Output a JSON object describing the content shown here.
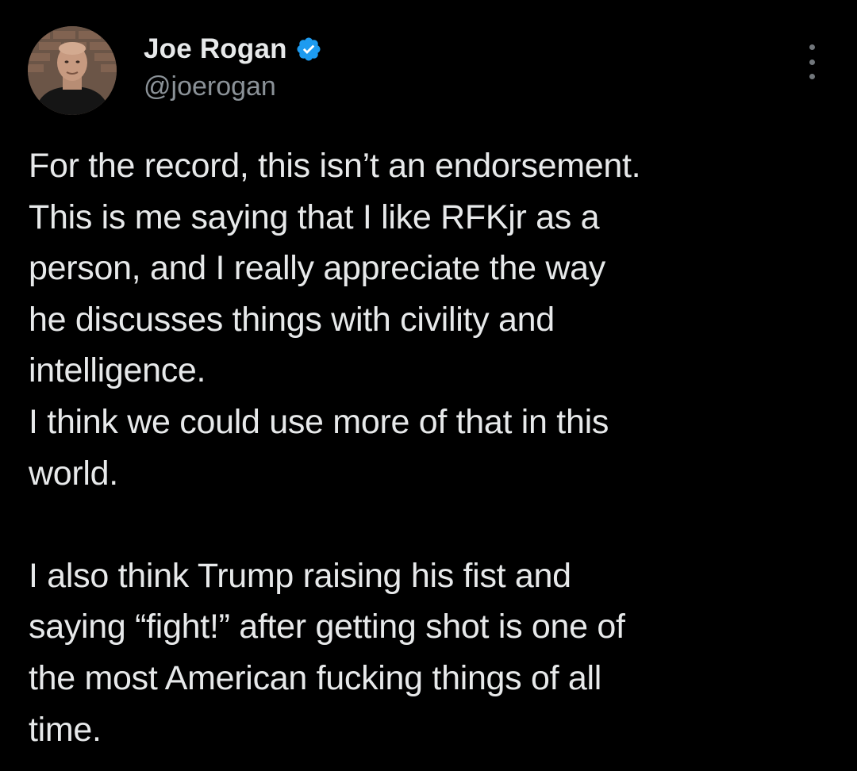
{
  "author": {
    "display_name": "Joe Rogan",
    "handle": "@joerogan",
    "verified": true,
    "verified_color": "#1d9bf0"
  },
  "menu": {
    "icon": "more-vertical-icon"
  },
  "tweet": {
    "lines": [
      "For the record, this isn’t an endorsement.",
      "This is me saying that I like RFKjr as a",
      "person, and I really appreciate the way",
      "he discusses things with civility and",
      "intelligence.",
      "I think we could use more of that in this",
      "world.",
      "",
      "I also think Trump raising his fist and",
      "saying “fight!” after getting shot is one of",
      "the most American fucking things of all",
      "time."
    ]
  },
  "theme": {
    "background": "#000000",
    "text_color": "#e7e9ea",
    "secondary_text_color": "#8b9298"
  }
}
